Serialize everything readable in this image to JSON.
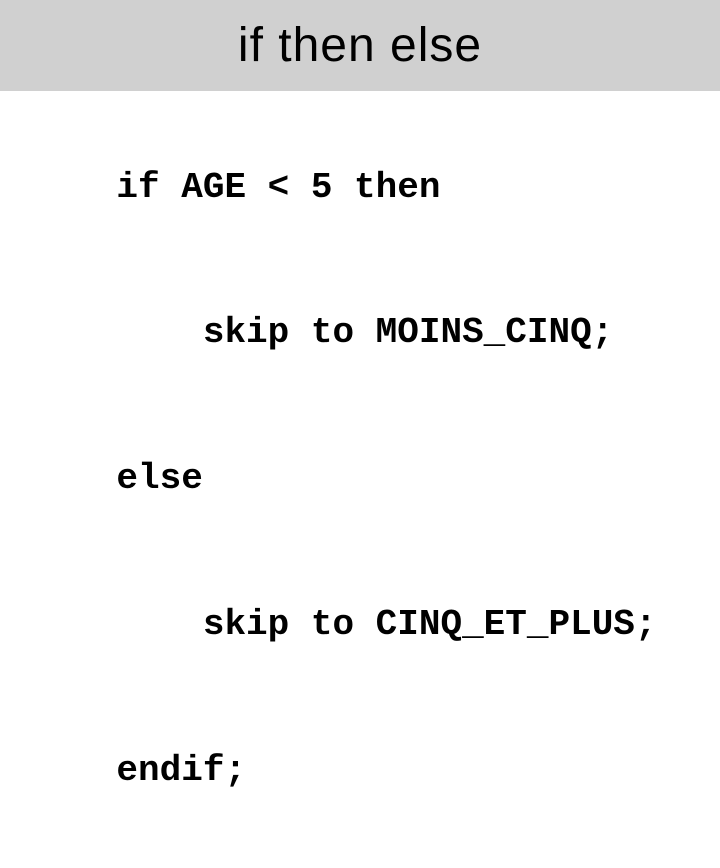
{
  "header": {
    "title": "if then else"
  },
  "code": {
    "line1": "if AGE < 5 then",
    "line2": "    skip to MOINS_CINQ;",
    "line3": "else",
    "line4": "    skip to CINQ_ET_PLUS;",
    "line5": "endif;"
  }
}
